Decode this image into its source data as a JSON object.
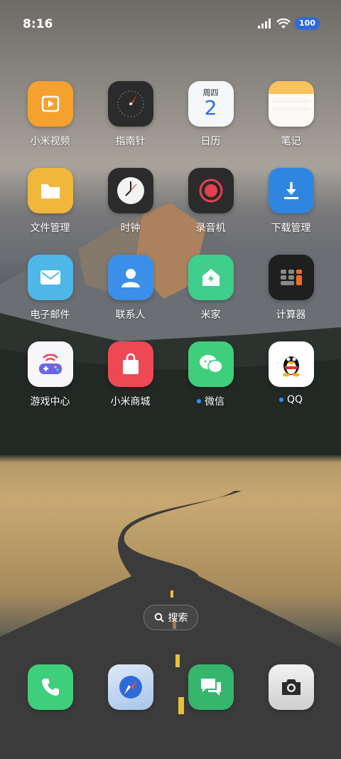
{
  "status_bar": {
    "time": "8:16",
    "battery": "100"
  },
  "apps": [
    {
      "label": "小米视频",
      "icon": "play-video-icon",
      "badge_dot": false
    },
    {
      "label": "指南针",
      "icon": "compass-icon",
      "badge_dot": false
    },
    {
      "label": "日历",
      "icon": "calendar-icon",
      "badge_dot": false,
      "weekday": "周四",
      "day": "2"
    },
    {
      "label": "笔记",
      "icon": "notes-icon",
      "badge_dot": false
    },
    {
      "label": "文件管理",
      "icon": "folder-icon",
      "badge_dot": false
    },
    {
      "label": "时钟",
      "icon": "clock-icon",
      "badge_dot": false
    },
    {
      "label": "录音机",
      "icon": "recorder-icon",
      "badge_dot": false
    },
    {
      "label": "下载管理",
      "icon": "download-icon",
      "badge_dot": false
    },
    {
      "label": "电子邮件",
      "icon": "mail-icon",
      "badge_dot": false
    },
    {
      "label": "联系人",
      "icon": "contacts-icon",
      "badge_dot": false
    },
    {
      "label": "米家",
      "icon": "mi-home-icon",
      "badge_dot": false
    },
    {
      "label": "计算器",
      "icon": "calculator-icon",
      "badge_dot": false
    },
    {
      "label": "游戏中心",
      "icon": "gamepad-icon",
      "badge_dot": false
    },
    {
      "label": "小米商城",
      "icon": "shopping-bag-icon",
      "badge_dot": false
    },
    {
      "label": "微信",
      "icon": "wechat-icon",
      "badge_dot": true
    },
    {
      "label": "QQ",
      "icon": "qq-penguin-icon",
      "badge_dot": true
    }
  ],
  "search": {
    "label": "搜索"
  },
  "dock": [
    {
      "icon": "phone-icon"
    },
    {
      "icon": "browser-compass-icon"
    },
    {
      "icon": "messages-icon"
    },
    {
      "icon": "camera-icon"
    }
  ]
}
